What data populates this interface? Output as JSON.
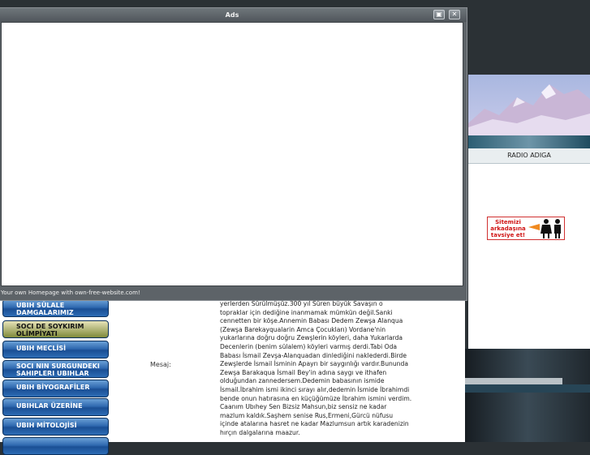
{
  "ads_window": {
    "title": "Ads",
    "footer_text": "Your own Homepage with own-free-website.com!",
    "restore_glyph": "▣",
    "close_glyph": "✕"
  },
  "menu": {
    "items": [
      {
        "label": "UBIH SÜLALE\nDAMGALARIMIZ"
      },
      {
        "label": "SOCI DE SOYKIRIM\nOLİMPİYATI"
      },
      {
        "label": "UBIH MECLİSİ"
      },
      {
        "label": "SOCI NIN SURGUNDEKI\nSAHIPLERI UBIHLAR"
      },
      {
        "label": "UBIH BİYOGRAFİLER"
      },
      {
        "label": "UBIHLAR ÜZERİNE"
      },
      {
        "label": "UBIH MİTOLOJİSİ"
      }
    ]
  },
  "form": {
    "mesaj_label": "Mesaj:",
    "message": "yerlerden Sürülmüşüz.300 yıl Süren büyük Savaşın o\ntopraklar için dediğine inanmamak mümkün değil.Sanki\ncennetten bir köşe.Annemin Babası Dedem Zewşa Alanqua\n(Zewşa Barekayqualarin Amca Çocukları) Vordane'nin\nyukarlarına doğru doğru Zewşlerin köyleri, daha Yukarlarda\nDecenlerin (benim sülalem) köyleri varmış derdi.Tabi Oda\nBabası İsmail Zevşa-Alanquadan dinlediğini naklederdi.Birde\nZewşlerde İsmail İsminin Apayrı bir saygınlığı vardır.Bununda\nZewşa Barakaqua İsmail Bey'in adına saygı ve ithafen\nolduğundan zannedersem.Dedemin babasının ismide\nİsmail.İbrahim ismi ikinci sırayı alır,dedemin İsmide İbrahimdi\nbende onun hatırasına en küçüğümüze İbrahim ismini verdim.\nCaanım Ubıhey Sen Bizsiz Mahsun,biz sensiz ne kadar\nmazlum kaldık.Saşhem senise Rus,Ermeni,Gürcü nüfusu\niçinde atalarına hasret ne kadar Mazlumsun artık karadenizin\nhırçın dalgalarına maazur."
  },
  "sidebar_right": {
    "radio_label": "RADIO ADIGA",
    "recommend_text": "Sitemizi\narkadaşına\ntavsiye et!"
  },
  "colors": {
    "menu_blue": "#2f69b0",
    "recommend_red": "#d01515",
    "window_gray": "#5d6368"
  }
}
